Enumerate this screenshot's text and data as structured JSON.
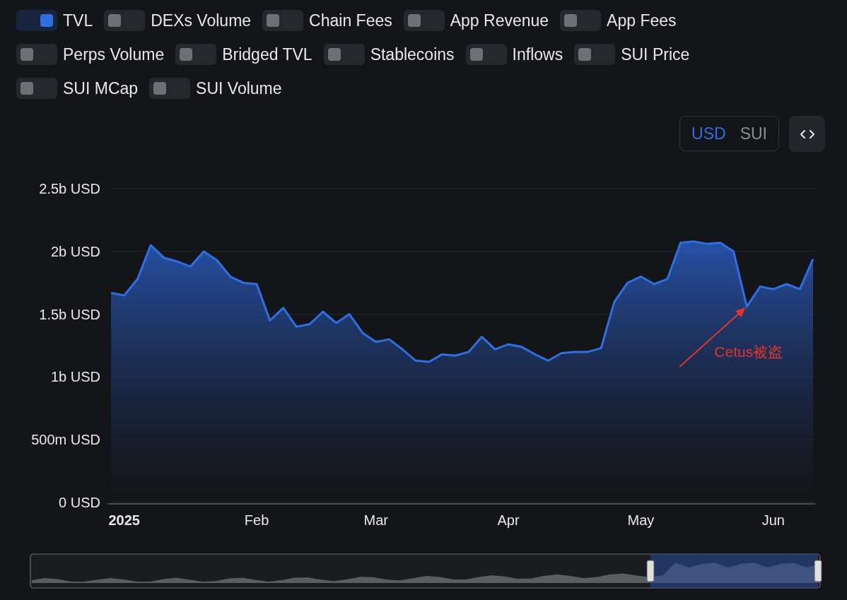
{
  "toggles": [
    {
      "label": "TVL",
      "on": true
    },
    {
      "label": "DEXs Volume",
      "on": false
    },
    {
      "label": "Chain Fees",
      "on": false
    },
    {
      "label": "App Revenue",
      "on": false
    },
    {
      "label": "App Fees",
      "on": false
    },
    {
      "label": "Perps Volume",
      "on": false
    },
    {
      "label": "Bridged TVL",
      "on": false
    },
    {
      "label": "Stablecoins",
      "on": false
    },
    {
      "label": "Inflows",
      "on": false
    },
    {
      "label": "SUI Price",
      "on": false
    },
    {
      "label": "SUI MCap",
      "on": false
    },
    {
      "label": "SUI Volume",
      "on": false
    }
  ],
  "currency": [
    {
      "label": "USD",
      "selected": true
    },
    {
      "label": "SUI",
      "selected": false
    }
  ],
  "chart": {
    "chart_data": {
      "type": "area",
      "grid": true,
      "categories": [
        null,
        "2025",
        null,
        null,
        null,
        null,
        null,
        null,
        null,
        null,
        null,
        "Feb",
        null,
        null,
        null,
        null,
        null,
        null,
        null,
        null,
        "Mar",
        null,
        null,
        null,
        null,
        null,
        null,
        null,
        null,
        null,
        "Apr",
        null,
        null,
        null,
        null,
        null,
        null,
        null,
        null,
        null,
        "May",
        null,
        null,
        null,
        null,
        null,
        null,
        null,
        null,
        null,
        "Jun",
        null,
        null,
        null
      ],
      "series": [
        {
          "color": "#2f6fe0",
          "values": [
            1670000000,
            1650000000,
            1780000000,
            2050000000,
            1950000000,
            1920000000,
            1880000000,
            2000000000,
            1930000000,
            1800000000,
            1750000000,
            1740000000,
            1450000000,
            1550000000,
            1400000000,
            1420000000,
            1520000000,
            1430000000,
            1500000000,
            1350000000,
            1280000000,
            1300000000,
            1220000000,
            1130000000,
            1120000000,
            1180000000,
            1170000000,
            1200000000,
            1320000000,
            1220000000,
            1260000000,
            1240000000,
            1180000000,
            1130000000,
            1190000000,
            1200000000,
            1200000000,
            1230000000,
            1600000000,
            1750000000,
            1800000000,
            1740000000,
            1780000000,
            2070000000,
            2080000000,
            2060000000,
            2070000000,
            2000000000,
            1560000000,
            1720000000,
            1700000000,
            1740000000,
            1700000000,
            1940000000
          ]
        }
      ],
      "ylim": [
        0,
        2500000000
      ],
      "yticks": [
        {
          "value": 0,
          "label": "0 USD"
        },
        {
          "value": 500000000,
          "label": "500m USD"
        },
        {
          "value": 1000000000,
          "label": "1b USD"
        },
        {
          "value": 1500000000,
          "label": "1.5b USD"
        },
        {
          "value": 2000000000,
          "label": "2b USD"
        },
        {
          "value": 2500000000,
          "label": "2.5b USD"
        }
      ],
      "annotations": [
        {
          "text": "Cetus被盗",
          "y": 1560000000
        }
      ]
    }
  }
}
